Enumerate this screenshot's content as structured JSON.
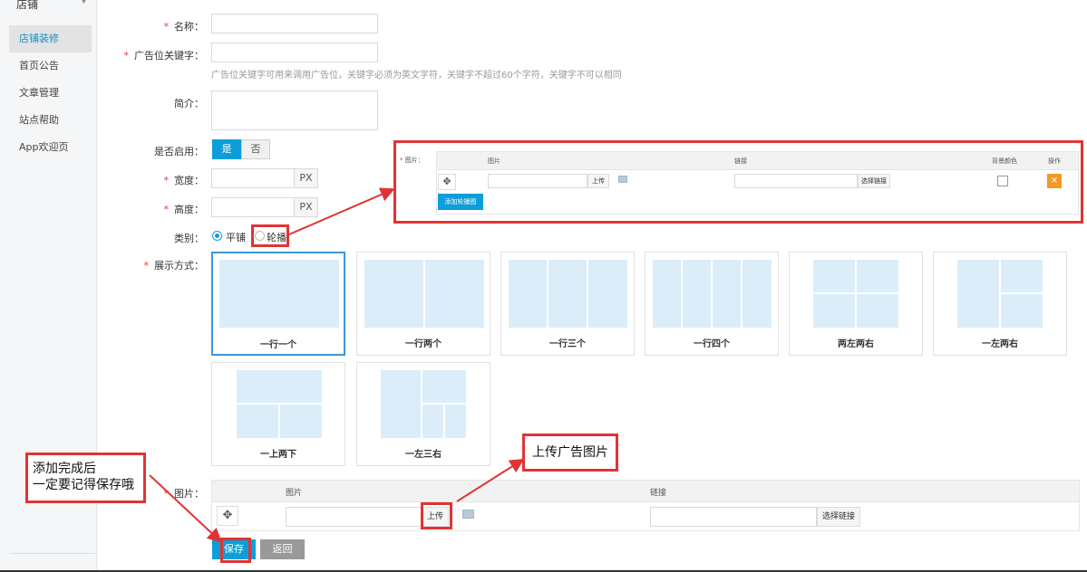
{
  "sidebar": {
    "title": "店铺",
    "items": [
      {
        "label": "店铺装修",
        "active": true
      },
      {
        "label": "首页公告",
        "active": false
      },
      {
        "label": "文章管理",
        "active": false
      },
      {
        "label": "站点帮助",
        "active": false
      },
      {
        "label": "App欢迎页",
        "active": false
      }
    ]
  },
  "form": {
    "name_label": "名称：",
    "keyword_label": "广告位关键字：",
    "keyword_hint": "广告位关键字可用来调用广告位，关键字必须为英文字符，关键字不超过60个字符，关键字不可以相同",
    "intro_label": "简介：",
    "enabled_label": "是否启用：",
    "enabled_yes": "是",
    "enabled_no": "否",
    "width_label": "宽度：",
    "height_label": "高度：",
    "unit": "PX",
    "type_label": "类别：",
    "type_tile": "平铺",
    "type_carousel": "轮播",
    "display_label": "展示方式：",
    "display_options": [
      "一行一个",
      "一行两个",
      "一行三个",
      "一行四个",
      "两左两右",
      "一左两右",
      "一上两下",
      "一左三右"
    ],
    "image_label": "图片：",
    "col_image": "图片",
    "col_link": "链接",
    "upload": "上传",
    "choose_link": "选择链接",
    "save": "保存",
    "back": "返回"
  },
  "popup": {
    "image_label": "图片：",
    "col_image": "图片",
    "col_link": "链接",
    "col_bg": "背景颜色",
    "col_op": "操作",
    "upload": "上传",
    "choose_link": "选择链接",
    "add": "添加轮播图",
    "del": "×"
  },
  "annotations": {
    "save_note_line1": "添加完成后",
    "save_note_line2": "一定要记得保存哦",
    "upload_note": "上传广告图片"
  },
  "colors": {
    "accent": "#0c9ed9",
    "annotation": "#e03434",
    "required": "#e4393c",
    "delete": "#f39a24"
  }
}
